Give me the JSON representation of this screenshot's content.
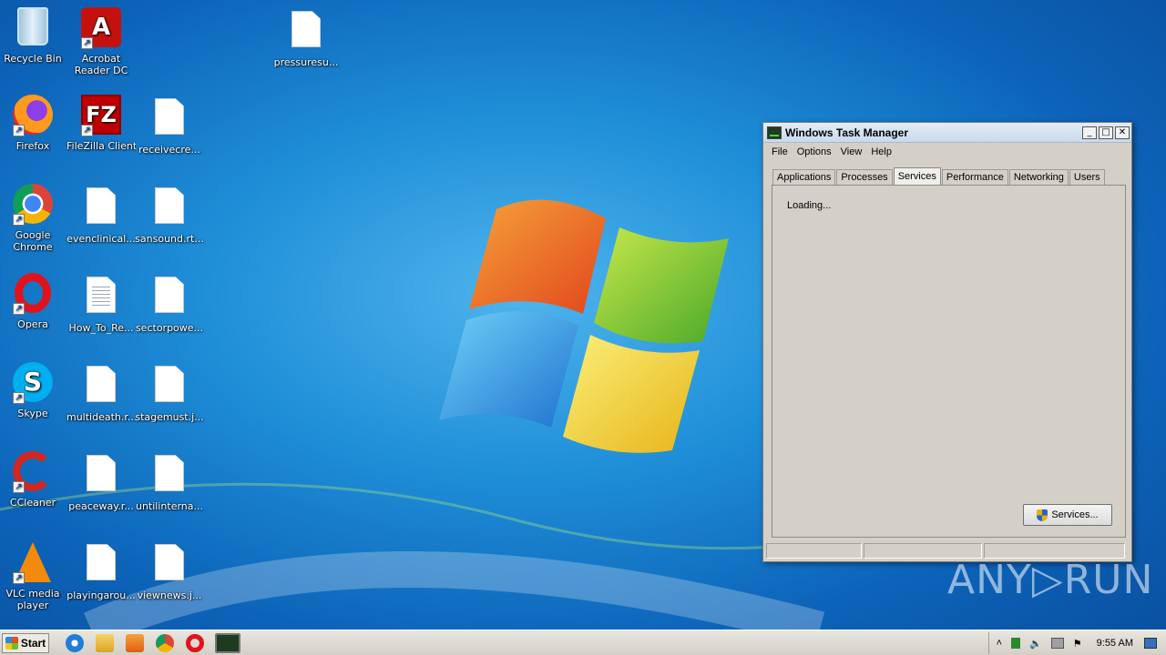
{
  "desktop": {
    "icons": [
      {
        "label": "Recycle Bin"
      },
      {
        "label": "Acrobat\nReader DC"
      },
      {
        "label": "pressuresu..."
      },
      {
        "label": "Firefox"
      },
      {
        "label": "FileZilla Client"
      },
      {
        "label": "receivecre..."
      },
      {
        "label": "Google\nChrome"
      },
      {
        "label": "evenclinical..."
      },
      {
        "label": "sansound.rt..."
      },
      {
        "label": "Opera"
      },
      {
        "label": "How_To_Re..."
      },
      {
        "label": "sectorpowe..."
      },
      {
        "label": "Skype"
      },
      {
        "label": "multideath.r..."
      },
      {
        "label": "stagemust.j..."
      },
      {
        "label": "CCleaner"
      },
      {
        "label": "peaceway.r..."
      },
      {
        "label": "untilinterna..."
      },
      {
        "label": "VLC media\nplayer"
      },
      {
        "label": "playingarou..."
      },
      {
        "label": "viewnews.j..."
      }
    ]
  },
  "task_manager": {
    "title": "Windows Task Manager",
    "menu": [
      "File",
      "Options",
      "View",
      "Help"
    ],
    "tabs": [
      "Applications",
      "Processes",
      "Services",
      "Performance",
      "Networking",
      "Users"
    ],
    "active_tab": "Services",
    "loading_text": "Loading...",
    "services_button": "Services...",
    "window_buttons": {
      "minimize": "_",
      "maximize": "□",
      "close": "✕"
    }
  },
  "watermark": "ANY▷RUN",
  "taskbar": {
    "start_label": "Start",
    "quick_launch": [
      "ie-icon",
      "explorer-icon",
      "media-player-icon",
      "chrome-icon",
      "opera-icon",
      "task-manager-icon"
    ],
    "clock": "9:55 AM"
  }
}
